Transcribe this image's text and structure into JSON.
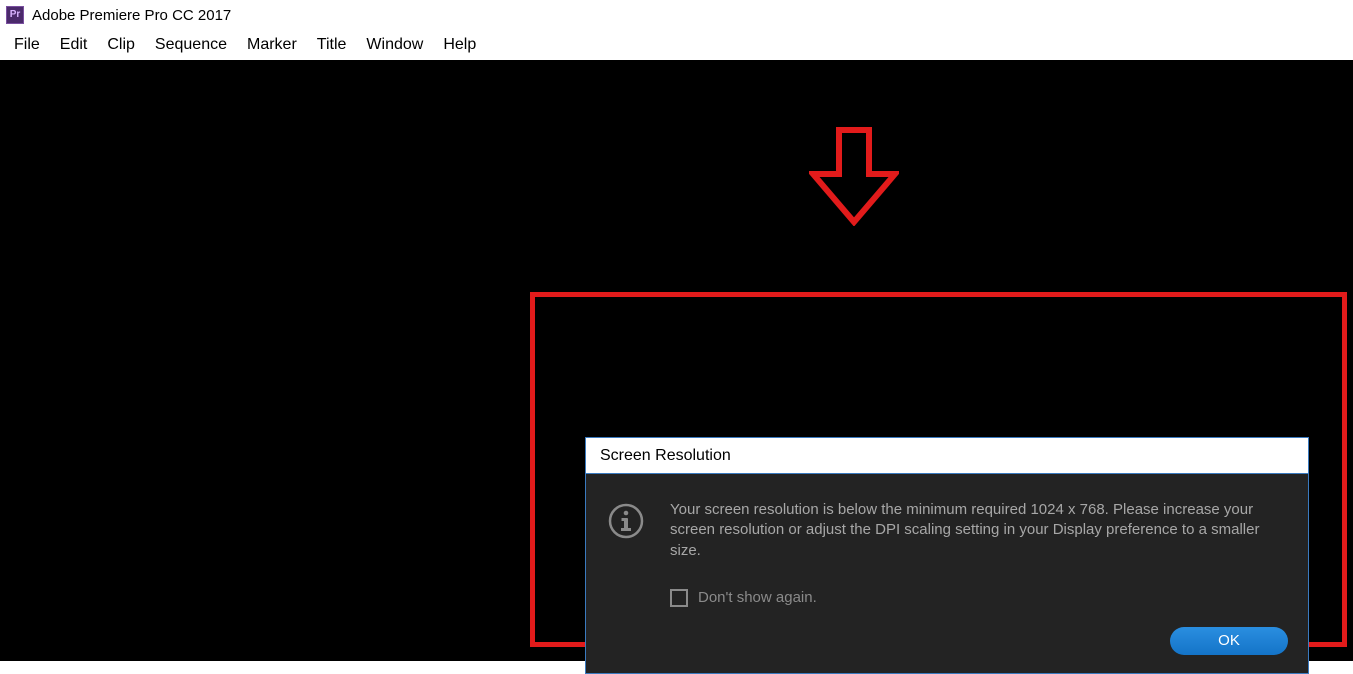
{
  "app": {
    "icon_text": "Pr",
    "title": "Adobe Premiere Pro CC 2017"
  },
  "menubar": {
    "items": [
      "File",
      "Edit",
      "Clip",
      "Sequence",
      "Marker",
      "Title",
      "Window",
      "Help"
    ]
  },
  "dialog": {
    "title": "Screen Resolution",
    "message": "Your screen resolution is below the minimum required 1024 x 768. Please increase your screen resolution or adjust the DPI scaling setting in your Display preference to a smaller size.",
    "checkbox_label": "Don't show again.",
    "ok_label": "OK"
  },
  "annotation": {
    "color": "#e21b1b"
  }
}
